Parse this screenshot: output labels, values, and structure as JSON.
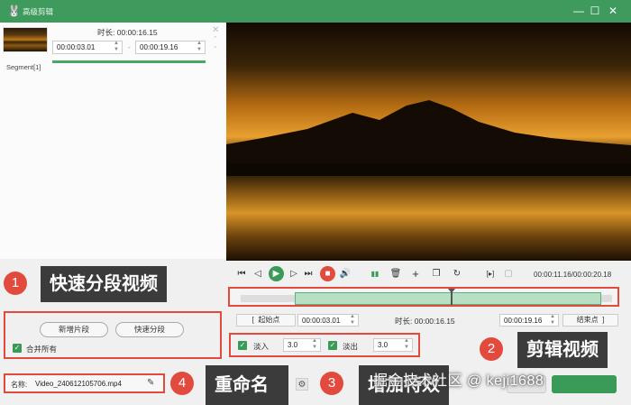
{
  "window": {
    "logo": "🐰",
    "title": "高级剪辑",
    "minimize": "—",
    "maximize": "☐",
    "close": "✕"
  },
  "segment": {
    "duration_label": "时长:",
    "duration_value": "00:00:16.15",
    "start_time": "00:00:03.01",
    "end_time": "00:00:19.16",
    "dash": "-",
    "label": "Segment[1]",
    "close_glyph": "✕",
    "arrows": "⌃\n⌄"
  },
  "player": {
    "timecode": "00:00:11.16/00:00:20.18"
  },
  "trim": {
    "start_bracket": "[",
    "start_label": "起始点",
    "start_value": "00:00:03.01",
    "duration_label": "时长:",
    "duration_value": "00:00:16.15",
    "end_value": "00:00:19.16",
    "end_label": "结束点",
    "end_bracket": "]"
  },
  "fade": {
    "in_label": "淡入",
    "in_value": "3.0",
    "out_label": "淡出",
    "out_value": "3.0"
  },
  "left_actions": {
    "new_segment": "新增片段",
    "quick_split": "快速分段",
    "merge_all": "合并所有"
  },
  "output": {
    "name_label": "名称:",
    "name_value": "Video_240612105706.mp4",
    "gear": "⚙"
  },
  "annotations": [
    {
      "number": "1",
      "text": "快速分段视频"
    },
    {
      "number": "2",
      "text": "剪辑视频"
    },
    {
      "number": "3",
      "text": "增加特效"
    },
    {
      "number": "4",
      "text": "重命名"
    }
  ],
  "watermark": "掘金技术社区 @ keji1688",
  "icons": {
    "to-start": "⏮",
    "prev-frame": "◁",
    "play": "▶",
    "next-frame": "▷",
    "to-end": "⏭",
    "stop": "■",
    "volume": "🔊",
    "split": "▮▮",
    "delete": "🗑",
    "add": "+",
    "copy": "❐",
    "reset": "↻",
    "bracket-mark": "[▸]",
    "snapshot": "▢",
    "checkmark": "✓",
    "spin": "⌃⌄",
    "pencil": "✎"
  },
  "colors": {
    "brand_green": "#3f9b5d",
    "accent_red": "#e24a3e",
    "callout_bg": "#3b3b3b"
  }
}
